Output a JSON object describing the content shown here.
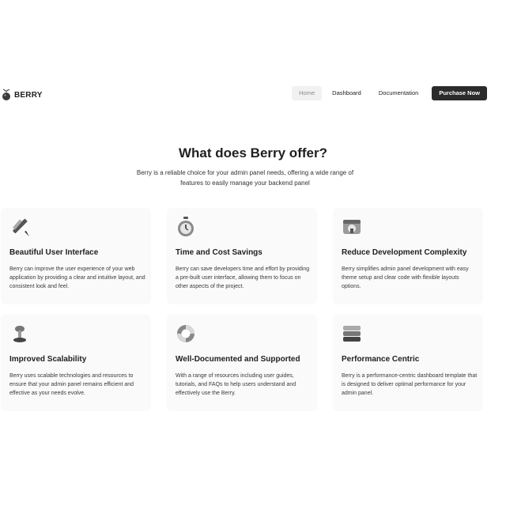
{
  "brand": {
    "name": "BERRY",
    "logo_icon": "berry-logo-icon"
  },
  "nav": {
    "items": [
      {
        "label": "Home"
      },
      {
        "label": "Dashboard"
      },
      {
        "label": "Documentation"
      }
    ],
    "cta_label": "Purchase Now"
  },
  "hero": {
    "title": "What does Berry offer?",
    "subtitle": "Berry is a reliable choice for your admin panel needs, offering a wide range of features to easily manage your backend panel"
  },
  "features": [
    {
      "icon": "design-tools-icon",
      "title": "Beautiful User Interface",
      "description": "Berry can improve the user experience of your web application by providing a clear and intuitive layout, and consistent look and feel."
    },
    {
      "icon": "stopwatch-icon",
      "title": "Time and Cost Savings",
      "description": "Berry can save developers time and effort by providing a pre-built user interface, allowing them to focus on other aspects of the project."
    },
    {
      "icon": "theme-window-icon",
      "title": "Reduce Development Complexity",
      "description": "Berry simplifies admin panel development with easy theme setup and clear code with flexible layouts options."
    },
    {
      "icon": "scalability-icon",
      "title": "Improved Scalability",
      "description": "Berry uses scalable technologies and resources to ensure that your admin panel remains efficient and effective as your needs evolve."
    },
    {
      "icon": "lifebuoy-icon",
      "title": "Well-Documented and Supported",
      "description": "With a range of resources including user guides, tutorials, and FAQs to help users understand and effectively use the Berry."
    },
    {
      "icon": "stack-icon",
      "title": "Performance Centric",
      "description": "Berry is a performance-centric dashboard template that is designed to deliver optimal performance for your admin panel."
    }
  ]
}
